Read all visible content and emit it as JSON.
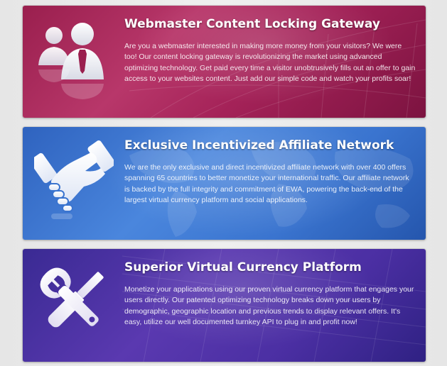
{
  "features": [
    {
      "title": "Webmaster Content Locking Gateway",
      "description": "Are you a webmaster interested in making more money from your visitors? We were too! Our content locking gateway is revolutionizing the market using advanced optimizing technology. Get paid every time a visitor unobtrusively fills out an offer to gain access to your websites content. Just add our simple code and watch your profits soar!",
      "icon": "users-icon",
      "color": "#a42258"
    },
    {
      "title": "Exclusive Incentivized Affiliate Network",
      "description": "We are the only exclusive and direct incentivized affiliate network with over 400 offers spanning 65 countries to better monetize your international traffic. Our affiliate network is backed by the full integrity and commitment of EWA, powering the back-end of the largest virtual currency platform and social applications.",
      "icon": "handshake-icon",
      "color": "#3a74cf"
    },
    {
      "title": "Superior Virtual Currency Platform",
      "description": "Monetize your applications using our proven virtual currency platform that engages your users directly. Our patented optimizing technology breaks down your users by demographic, geographic location and previous trends to display relevant offers. It's easy, utilize our well documented turnkey API to plug in and profit now!",
      "icon": "tools-icon",
      "color": "#4b2fa3"
    }
  ]
}
